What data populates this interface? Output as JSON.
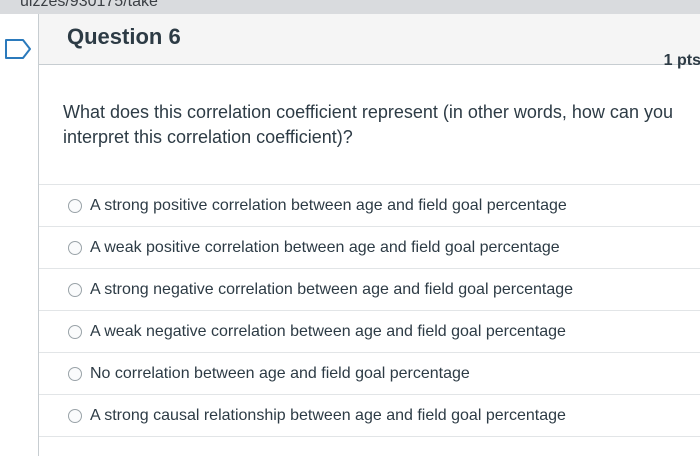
{
  "browser": {
    "url_fragment": "uizzes/930175/take"
  },
  "question": {
    "title": "Question 6",
    "points": "1 pts",
    "text": "What does this correlation coefficient represent (in other words, how can you interpret this correlation coefficient)?"
  },
  "answers": [
    {
      "label": "A strong positive correlation between age and field goal percentage"
    },
    {
      "label": "A weak positive correlation between age and field goal percentage"
    },
    {
      "label": "A strong negative correlation between age and field goal percentage"
    },
    {
      "label": "A weak negative correlation between age and field goal percentage"
    },
    {
      "label": "No correlation between age and field goal percentage"
    },
    {
      "label": "A strong causal relationship between age and field goal percentage"
    }
  ],
  "icons": {
    "flag": "flag-question-icon",
    "radio": "radio-button-icon"
  },
  "colors": {
    "text": "#2d3b45",
    "header_bg": "#f5f5f5",
    "border": "#c7cdd1",
    "flag_blue": "#2b7abc"
  }
}
